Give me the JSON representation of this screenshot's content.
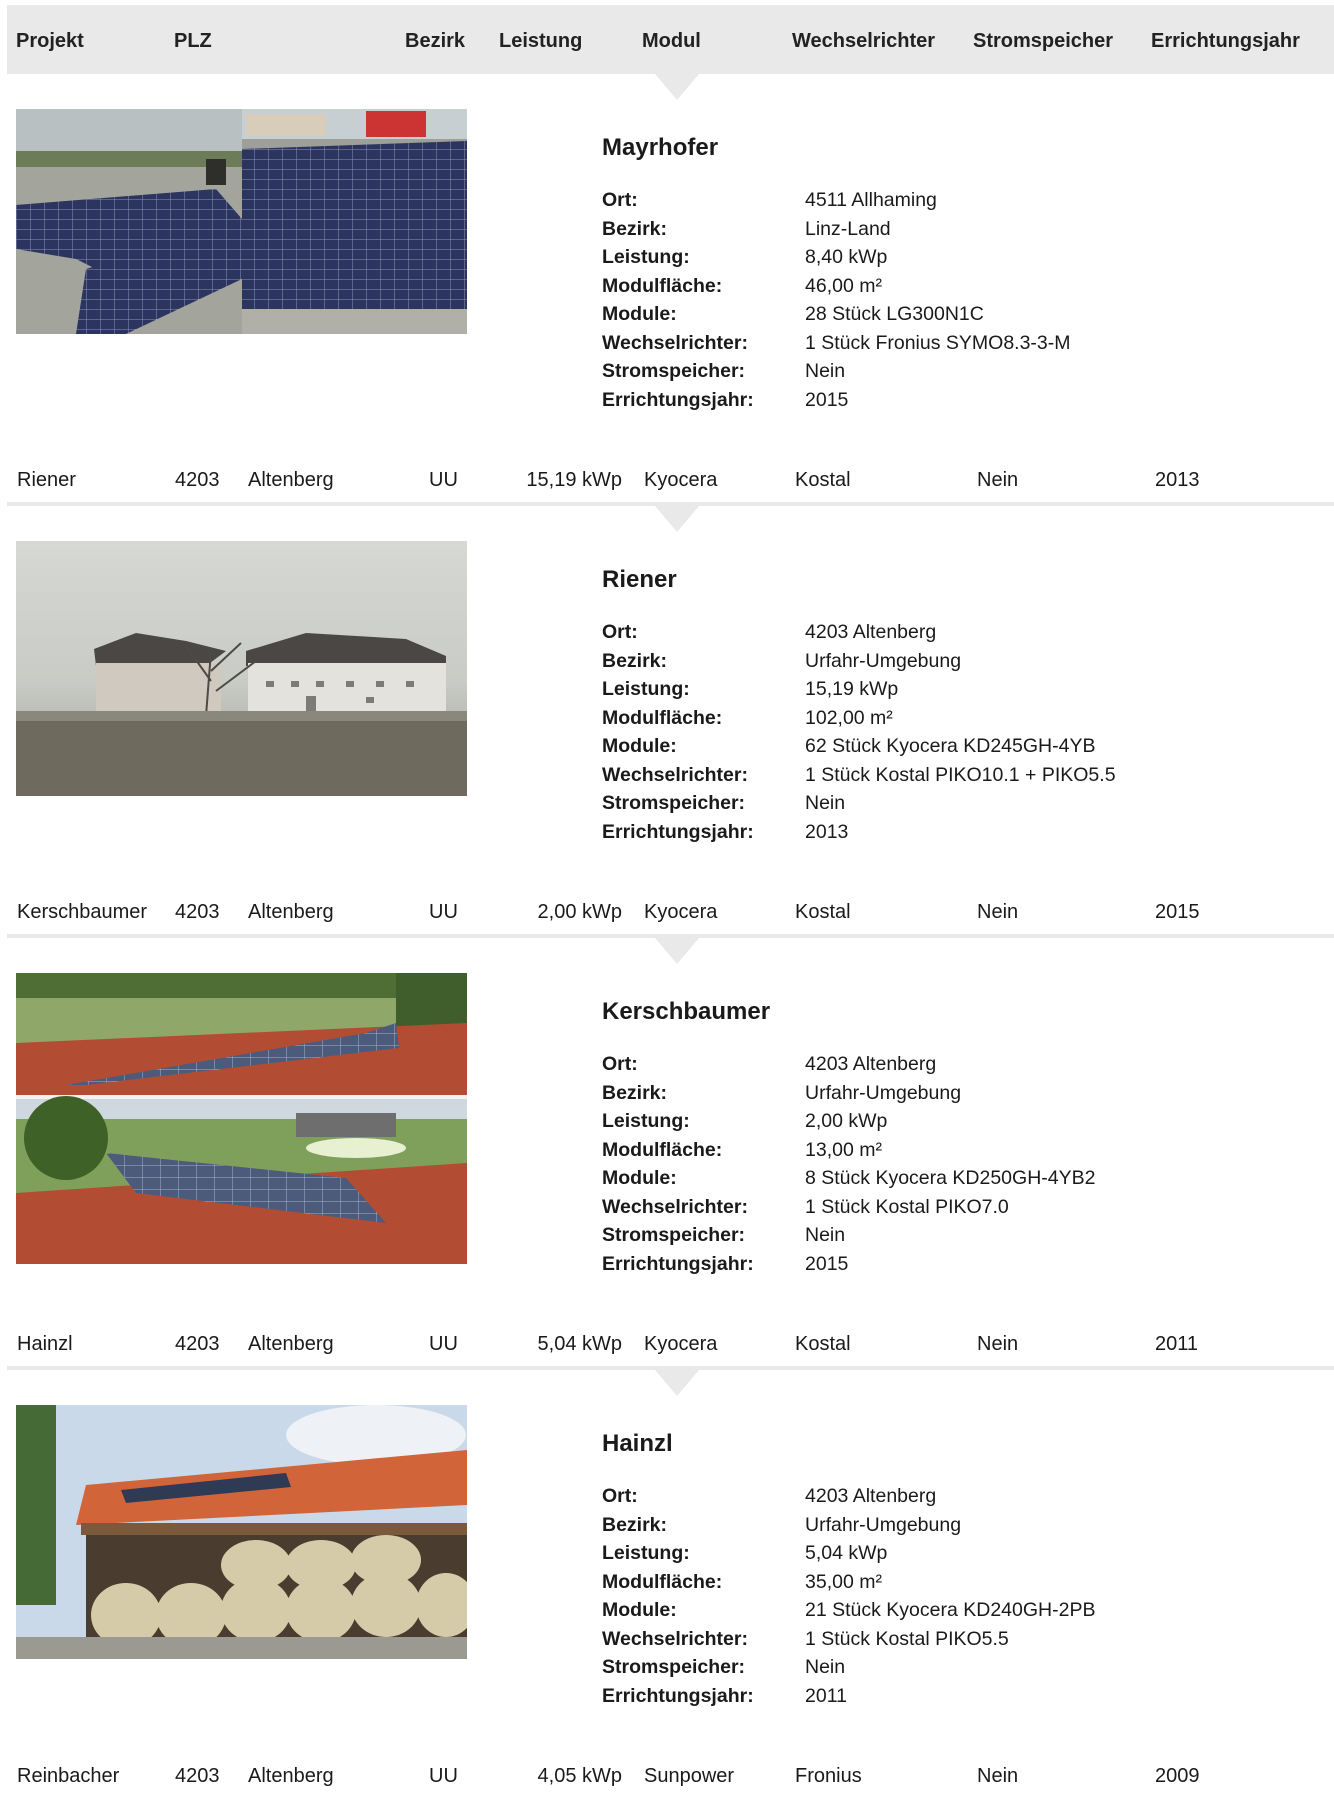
{
  "header": {
    "columns": [
      "Projekt",
      "PLZ",
      "Bezirk",
      "Leistung",
      "Modul",
      "Wechselrichter",
      "Stromspeicher",
      "Errichtungsjahr"
    ]
  },
  "detail_labels": [
    "Ort:",
    "Bezirk:",
    "Leistung:",
    "Modulfläche:",
    "Module:",
    "Wechselrichter:",
    "Stromspeicher:",
    "Errichtungsjahr:"
  ],
  "projects": [
    {
      "name": "Mayrhofer",
      "details": [
        "4511 Allhaming",
        "Linz-Land",
        "8,40 kWp",
        "46,00 m²",
        "28 Stück LG300N1C",
        "1 Stück Fronius SYMO8.3-3-M",
        "Nein",
        "2015"
      ]
    },
    {
      "row": {
        "projekt": "Riener",
        "plz": "4203",
        "ort": "Altenberg",
        "bezirk": "UU",
        "leistung": "15,19 kWp",
        "modul": "Kyocera",
        "wechselrichter": "Kostal",
        "stromspeicher": "Nein",
        "jahr": "2013"
      },
      "name": "Riener",
      "details": [
        "4203 Altenberg",
        "Urfahr-Umgebung",
        "15,19 kWp",
        "102,00 m²",
        "62 Stück Kyocera KD245GH-4YB",
        "1 Stück Kostal PIKO10.1 + PIKO5.5",
        "Nein",
        "2013"
      ]
    },
    {
      "row": {
        "projekt": "Kerschbaumer",
        "plz": "4203",
        "ort": "Altenberg",
        "bezirk": "UU",
        "leistung": "2,00 kWp",
        "modul": "Kyocera",
        "wechselrichter": "Kostal",
        "stromspeicher": "Nein",
        "jahr": "2015"
      },
      "name": "Kerschbaumer",
      "details": [
        "4203 Altenberg",
        "Urfahr-Umgebung",
        "2,00 kWp",
        "13,00 m²",
        "8 Stück Kyocera KD250GH-4YB2",
        "1 Stück Kostal PIKO7.0",
        "Nein",
        "2015"
      ]
    },
    {
      "row": {
        "projekt": "Hainzl",
        "plz": "4203",
        "ort": "Altenberg",
        "bezirk": "UU",
        "leistung": "5,04 kWp",
        "modul": "Kyocera",
        "wechselrichter": "Kostal",
        "stromspeicher": "Nein",
        "jahr": "2011"
      },
      "name": "Hainzl",
      "details": [
        "4203 Altenberg",
        "Urfahr-Umgebung",
        "5,04 kWp",
        "35,00 m²",
        "21 Stück Kyocera KD240GH-2PB",
        "1 Stück Kostal PIKO5.5",
        "Nein",
        "2011"
      ]
    },
    {
      "row": {
        "projekt": "Reinbacher",
        "plz": "4203",
        "ort": "Altenberg",
        "bezirk": "UU",
        "leistung": "4,05 kWp",
        "modul": "Sunpower",
        "wechselrichter": "Fronius",
        "stromspeicher": "Nein",
        "jahr": "2009"
      }
    }
  ]
}
